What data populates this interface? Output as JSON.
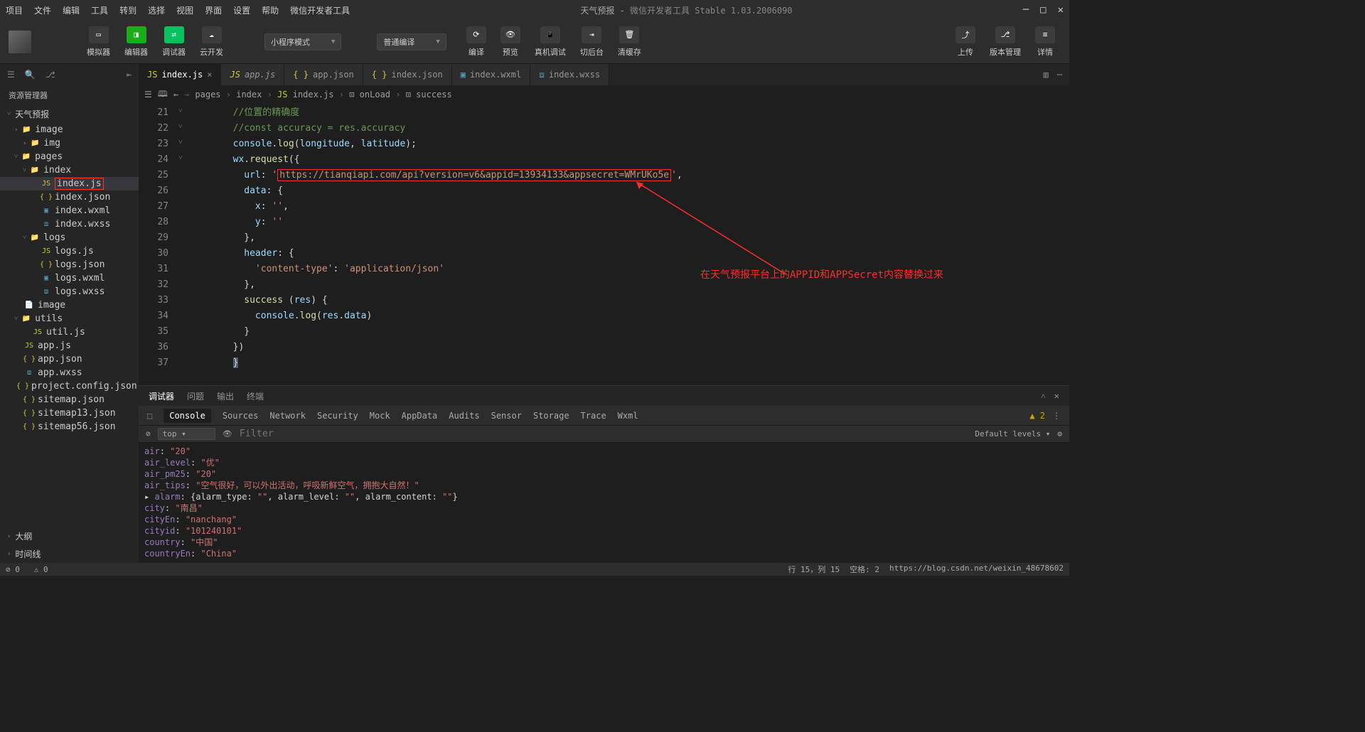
{
  "app": {
    "title": "天气预报",
    "subtitle": "微信开发者工具 Stable 1.03.2006090"
  },
  "menu": [
    "项目",
    "文件",
    "编辑",
    "工具",
    "转到",
    "选择",
    "视图",
    "界面",
    "设置",
    "帮助",
    "微信开发者工具"
  ],
  "toolbar": {
    "buttons": [
      {
        "icon": "▭",
        "label": "模拟器"
      },
      {
        "icon": "◨",
        "label": "编辑器",
        "cls": "green"
      },
      {
        "icon": "⇄",
        "label": "调试器",
        "cls": "blue"
      },
      {
        "icon": "☁",
        "label": "云开发"
      }
    ],
    "mode": "小程序模式",
    "compile": "普通编译",
    "actions": [
      {
        "icon": "⟳",
        "label": "编译"
      },
      {
        "icon": "👁",
        "label": "预览"
      },
      {
        "icon": "📱",
        "label": "真机调试"
      },
      {
        "icon": "⇥",
        "label": "切后台"
      },
      {
        "icon": "🗑",
        "label": "清缓存"
      }
    ],
    "right": [
      {
        "icon": "⤴",
        "label": "上传"
      },
      {
        "icon": "⎇",
        "label": "版本管理"
      },
      {
        "icon": "≡",
        "label": "详情"
      }
    ]
  },
  "explorer": {
    "title": "资源管理器",
    "root": "天气预报"
  },
  "tree": [
    {
      "d": 1,
      "t": "f",
      "n": "image"
    },
    {
      "d": 2,
      "t": "f",
      "n": "img"
    },
    {
      "d": 1,
      "t": "f",
      "n": "pages",
      "open": true
    },
    {
      "d": 2,
      "t": "f",
      "n": "index",
      "open": true
    },
    {
      "d": 3,
      "t": "js",
      "n": "index.js",
      "sel": true,
      "box": true
    },
    {
      "d": 3,
      "t": "json",
      "n": "index.json"
    },
    {
      "d": 3,
      "t": "wxml",
      "n": "index.wxml"
    },
    {
      "d": 3,
      "t": "wxss",
      "n": "index.wxss"
    },
    {
      "d": 2,
      "t": "f",
      "n": "logs",
      "open": true
    },
    {
      "d": 3,
      "t": "js",
      "n": "logs.js"
    },
    {
      "d": 3,
      "t": "json",
      "n": "logs.json"
    },
    {
      "d": 3,
      "t": "wxml",
      "n": "logs.wxml"
    },
    {
      "d": 3,
      "t": "wxss",
      "n": "logs.wxss"
    },
    {
      "d": 1,
      "t": "file",
      "n": "image"
    },
    {
      "d": 1,
      "t": "f",
      "n": "utils",
      "open": true
    },
    {
      "d": 2,
      "t": "js",
      "n": "util.js"
    },
    {
      "d": 1,
      "t": "js",
      "n": "app.js"
    },
    {
      "d": 1,
      "t": "json",
      "n": "app.json"
    },
    {
      "d": 1,
      "t": "wxss",
      "n": "app.wxss"
    },
    {
      "d": 1,
      "t": "json",
      "n": "project.config.json"
    },
    {
      "d": 1,
      "t": "json",
      "n": "sitemap.json"
    },
    {
      "d": 1,
      "t": "json",
      "n": "sitemap13.json"
    },
    {
      "d": 1,
      "t": "json",
      "n": "sitemap56.json"
    }
  ],
  "sections": [
    "大纲",
    "时间线"
  ],
  "tabs": [
    {
      "icon": "js",
      "label": "index.js",
      "active": true,
      "close": true
    },
    {
      "icon": "js",
      "label": "app.js",
      "it": true
    },
    {
      "icon": "json",
      "label": "app.json"
    },
    {
      "icon": "json",
      "label": "index.json"
    },
    {
      "icon": "wxml",
      "label": "index.wxml"
    },
    {
      "icon": "wxss",
      "label": "index.wxss"
    }
  ],
  "breadcrumb": [
    "pages",
    "index",
    "index.js",
    "onLoad",
    "success"
  ],
  "code": {
    "start": 21,
    "lines": [
      {
        "n": 21,
        "html": "<span class='c-comment'>//位置的精确度</span>"
      },
      {
        "n": 22,
        "html": "<span class='c-comment'>//const accuracy = res.accuracy</span>"
      },
      {
        "n": 23,
        "html": "<span class='c-ident'>console</span><span class='c-punc'>.</span><span class='c-func'>log</span><span class='c-punc'>(</span><span class='c-ident'>longitude</span><span class='c-punc'>, </span><span class='c-ident'>latitude</span><span class='c-punc'>);</span>"
      },
      {
        "n": 24,
        "html": "<span class='c-ident'>wx</span><span class='c-punc'>.</span><span class='c-func'>request</span><span class='c-punc'>({</span>"
      },
      {
        "n": 25,
        "html": "  <span class='c-prop'>url</span><span class='c-punc'>: </span><span class='c-str'>'</span><span class='url-box'>https://tianqiapi.com/api?version=v6&amp;appid=13934133&amp;appsecret=WMrUKo5e</span><span class='c-str'>'</span><span class='c-punc'>,</span>"
      },
      {
        "n": 26,
        "html": "  <span class='c-prop'>data</span><span class='c-punc'>: {</span>"
      },
      {
        "n": 27,
        "html": "    <span class='c-prop'>x</span><span class='c-punc'>: </span><span class='c-str'>''</span><span class='c-punc'>,</span>"
      },
      {
        "n": 28,
        "html": "    <span class='c-prop'>y</span><span class='c-punc'>: </span><span class='c-str'>''</span>"
      },
      {
        "n": 29,
        "html": "  <span class='c-punc'>},</span>"
      },
      {
        "n": 30,
        "html": "  <span class='c-prop'>header</span><span class='c-punc'>: {</span>"
      },
      {
        "n": 31,
        "html": "    <span class='c-str'>'content-type'</span><span class='c-punc'>: </span><span class='c-str'>'application/json'</span>"
      },
      {
        "n": 32,
        "html": "  <span class='c-punc'>},</span>"
      },
      {
        "n": 33,
        "html": "  <span class='c-func'>success</span> <span class='c-punc'>(</span><span class='c-ident'>res</span><span class='c-punc'>) {</span>"
      },
      {
        "n": 34,
        "html": "    <span class='c-ident'>console</span><span class='c-punc'>.</span><span class='c-func'>log</span><span class='c-punc'>(</span><span class='c-ident'>res</span><span class='c-punc'>.</span><span class='c-ident'>data</span><span class='c-punc'>)</span>"
      },
      {
        "n": 35,
        "html": "  <span class='c-punc'>}</span>"
      },
      {
        "n": 36,
        "html": "<span class='c-punc'>})</span>"
      },
      {
        "n": 37,
        "html": "<span class='c-punc' style='background:#515c6a'>}</span>"
      }
    ],
    "folds": {
      "24": "˅",
      "26": "˅",
      "30": "˅",
      "33": "˅"
    }
  },
  "annotation": "在天气预报平台上的APPID和APPSecret内容替换过来",
  "panel": {
    "tabs": [
      "调试器",
      "问题",
      "输出",
      "终端"
    ],
    "devtabs": [
      "Console",
      "Sources",
      "Network",
      "Security",
      "Mock",
      "AppData",
      "Audits",
      "Sensor",
      "Storage",
      "Trace",
      "Wxml"
    ],
    "warn": "2",
    "filter_ph": "Filter",
    "levels": "Default levels",
    "context": "top"
  },
  "console": [
    "  <span class='co-key'>air</span><span class='co-pun'>: </span><span class='co-str'>\"20\"</span>",
    "  <span class='co-key'>air_level</span><span class='co-pun'>: </span><span class='co-str'>\"优\"</span>",
    "  <span class='co-key'>air_pm25</span><span class='co-pun'>: </span><span class='co-str'>\"20\"</span>",
    "  <span class='co-key'>air_tips</span><span class='co-pun'>: </span><span class='co-str'>\"空气很好，可以外出活动，呼吸新鲜空气，拥抱大自然！\"</span>",
    "▸ <span class='co-key'>alarm</span><span class='co-pun'>: {alarm_type: </span><span class='co-str'>\"\"</span><span class='co-pun'>, alarm_level: </span><span class='co-str'>\"\"</span><span class='co-pun'>, alarm_content: </span><span class='co-str'>\"\"</span><span class='co-pun'>}</span>",
    "  <span class='co-key'>city</span><span class='co-pun'>: </span><span class='co-str'>\"南昌\"</span>",
    "  <span class='co-key'>cityEn</span><span class='co-pun'>: </span><span class='co-str'>\"nanchang\"</span>",
    "  <span class='co-key'>cityid</span><span class='co-pun'>: </span><span class='co-str'>\"101240101\"</span>",
    "  <span class='co-key'>country</span><span class='co-pun'>: </span><span class='co-str'>\"中国\"</span>",
    "  <span class='co-key'>countryEn</span><span class='co-pun'>: </span><span class='co-str'>\"China\"</span>"
  ],
  "status": {
    "left": [
      "⊘ 0",
      "⚠ 0"
    ],
    "right": [
      "行 15，列 15",
      "空格: 2",
      "https://blog.csdn.net/weixin_48678602"
    ]
  }
}
